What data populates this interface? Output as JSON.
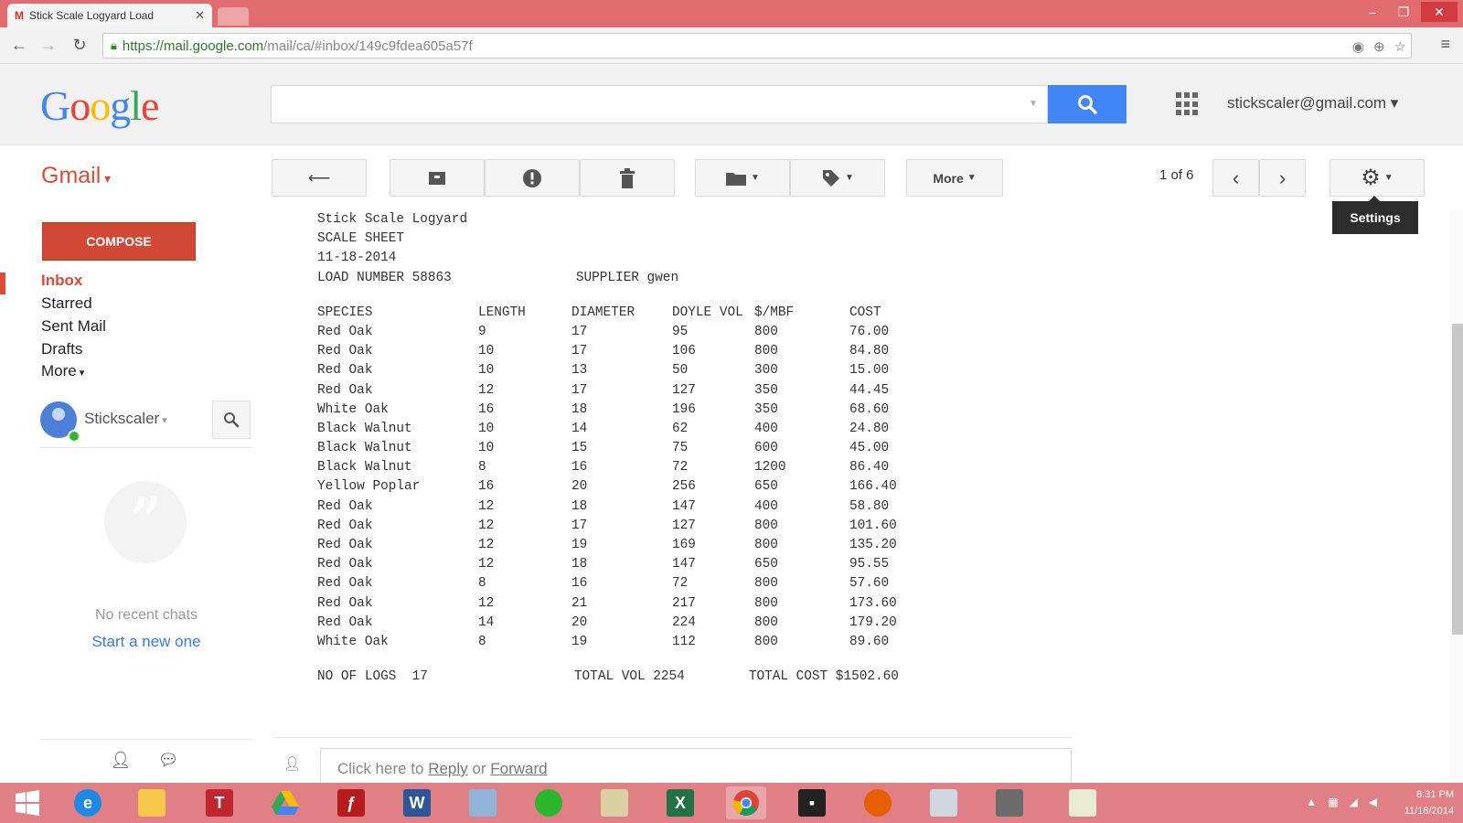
{
  "browser": {
    "tab_title": "Stick Scale Logyard Load",
    "tab_favicon": "M",
    "url_host": "https://mail.google.com",
    "url_path": "/mail/ca/#inbox/149c9fdea605a57f"
  },
  "header": {
    "logo": [
      "G",
      "o",
      "o",
      "g",
      "l",
      "e"
    ],
    "account": "stickscaler@gmail.com",
    "search_placeholder": ""
  },
  "toolbar": {
    "gmail_label": "Gmail",
    "more_label": "More",
    "pager": "1 of 6",
    "settings_tooltip": "Settings"
  },
  "sidebar": {
    "compose": "COMPOSE",
    "items": [
      {
        "label": "Inbox",
        "active": true
      },
      {
        "label": "Starred",
        "active": false
      },
      {
        "label": "Sent Mail",
        "active": false
      },
      {
        "label": "Drafts",
        "active": false
      },
      {
        "label": "More",
        "active": false
      }
    ],
    "hangouts_user": "Stickscaler",
    "no_recent_chats": "No recent chats",
    "start_new": "Start a new one"
  },
  "message": {
    "header_lines": [
      "Stick Scale Logyard",
      "SCALE SHEET",
      "11-18-2014"
    ],
    "load_number": "LOAD NUMBER 58863",
    "supplier": "SUPPLIER gwen",
    "columns": [
      "SPECIES",
      "LENGTH",
      "DIAMETER",
      "DOYLE VOL",
      "$/MBF",
      "COST"
    ],
    "rows": [
      [
        "Red Oak",
        "9",
        "17",
        "95",
        "800",
        "76.00"
      ],
      [
        "Red Oak",
        "10",
        "17",
        "106",
        "800",
        "84.80"
      ],
      [
        "Red Oak",
        "10",
        "13",
        "50",
        "300",
        "15.00"
      ],
      [
        "Red Oak",
        "12",
        "17",
        "127",
        "350",
        "44.45"
      ],
      [
        "White Oak",
        "16",
        "18",
        "196",
        "350",
        "68.60"
      ],
      [
        "Black Walnut",
        "10",
        "14",
        "62",
        "400",
        "24.80"
      ],
      [
        "Black Walnut",
        "10",
        "15",
        "75",
        "600",
        "45.00"
      ],
      [
        "Black Walnut",
        "8",
        "16",
        "72",
        "1200",
        "86.40"
      ],
      [
        "Yellow Poplar",
        "16",
        "20",
        "256",
        "650",
        "166.40"
      ],
      [
        "Red Oak",
        "12",
        "18",
        "147",
        "400",
        "58.80"
      ],
      [
        "Red Oak",
        "12",
        "17",
        "127",
        "800",
        "101.60"
      ],
      [
        "Red Oak",
        "12",
        "19",
        "169",
        "800",
        "135.20"
      ],
      [
        "Red Oak",
        "12",
        "18",
        "147",
        "650",
        "95.55"
      ],
      [
        "Red Oak",
        "8",
        "16",
        "72",
        "800",
        "57.60"
      ],
      [
        "Red Oak",
        "12",
        "21",
        "217",
        "800",
        "173.60"
      ],
      [
        "Red Oak",
        "14",
        "20",
        "224",
        "800",
        "179.20"
      ],
      [
        "White Oak",
        "8",
        "19",
        "112",
        "800",
        "89.60"
      ]
    ],
    "no_of_logs": "NO OF LOGS  17",
    "total_vol": "TOTAL VOL 2254",
    "total_cost": "TOTAL COST $1502.60"
  },
  "reply": {
    "prefix": "Click here to ",
    "reply_link": "Reply",
    "or": " or ",
    "forward_link": "Forward"
  },
  "taskbar": {
    "apps": [
      "windows-start",
      "internet-explorer",
      "file-explorer",
      "t-app",
      "google-drive",
      "acrobat-reader",
      "word",
      "folder-app",
      "green-circle-app",
      "notepad-app",
      "excel",
      "chrome",
      "terminal",
      "firefox",
      "satellite-app",
      "database-app",
      "ticket-app"
    ],
    "time": "8:31 PM",
    "date": "11/18/2014"
  },
  "colors": {
    "accent_red": "#dd4b39",
    "search_blue": "#4285f4",
    "compose_red": "#d14836",
    "title_bar": "#e06c70"
  }
}
